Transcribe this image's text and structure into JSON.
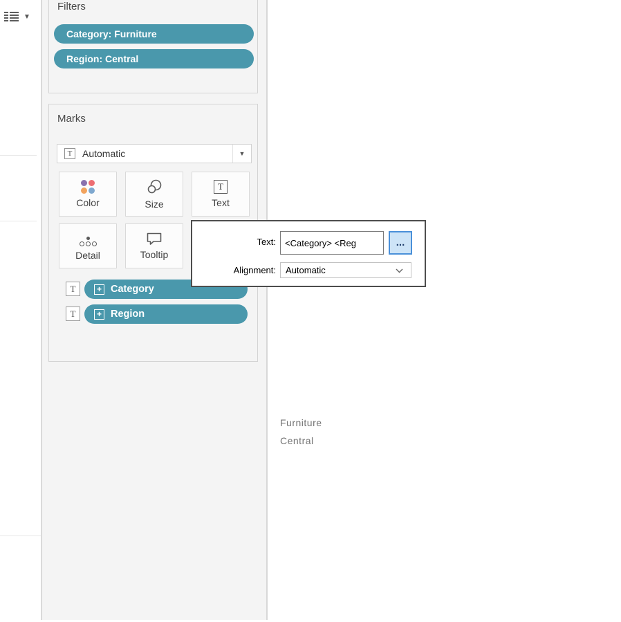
{
  "left_rail": {
    "caret_glyph": "▼"
  },
  "filters_card": {
    "title": "Filters",
    "pills": [
      {
        "label": "Category: Furniture"
      },
      {
        "label": "Region: Central"
      }
    ]
  },
  "marks_card": {
    "title": "Marks",
    "mark_type": {
      "selected": "Automatic",
      "icon_letter": "T",
      "caret_glyph": "▼"
    },
    "buttons": [
      {
        "label": "Color"
      },
      {
        "label": "Size"
      },
      {
        "label": "Text",
        "icon_letter": "T"
      },
      {
        "label": "Detail"
      },
      {
        "label": "Tooltip"
      }
    ],
    "shelf_pills": [
      {
        "mark_icon_letter": "T",
        "expand_glyph": "+",
        "label": "Category"
      },
      {
        "mark_icon_letter": "T",
        "expand_glyph": "+",
        "label": "Region"
      }
    ]
  },
  "text_popup": {
    "text_label": "Text:",
    "text_value": "<Category> <Reg",
    "more_button_label": "...",
    "alignment_label": "Alignment:",
    "alignment_value": "Automatic"
  },
  "canvas": {
    "line1": "Furniture",
    "line2": "Central"
  },
  "colors": {
    "pill_teal": "#4a98ac",
    "panel_bg": "#f4f4f4",
    "focus_button_bg": "#cde4f7",
    "focus_button_border": "#4a90d9"
  }
}
